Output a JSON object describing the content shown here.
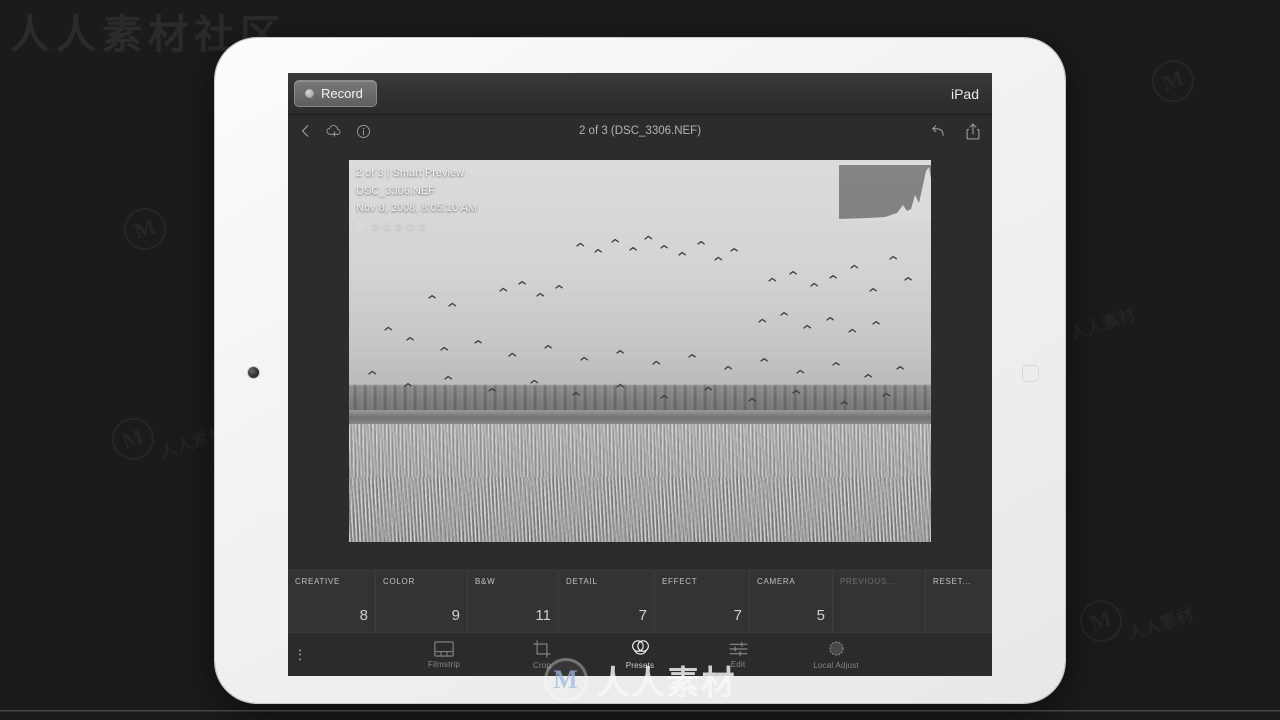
{
  "background": {
    "site_watermark": "人人素材社区",
    "logo_text": "人人素材",
    "logo_mark": "M",
    "tile_watermark": "人人素材"
  },
  "device": {
    "name": "iPad",
    "camera_icon": "front-camera",
    "home_icon": "home-button"
  },
  "recorder": {
    "record_label": "Record",
    "record_dot_icon": "record-dot",
    "device_label": "iPad"
  },
  "app": {
    "topnav": {
      "back_icon": "chevron-left-icon",
      "cloud_icon": "cloud-add-icon",
      "info_icon": "info-circle-icon",
      "title": "2 of 3 (DSC_3306.NEF)",
      "undo_icon": "undo-icon",
      "share_icon": "share-upload-icon"
    },
    "photo_overlay": {
      "line1": "2 of 3 | Smart Preview",
      "line2": "DSC_3306.NEF",
      "line3": "Nov 8, 2008, 8:05:10 AM",
      "flag_icon": "flag-outline-icon",
      "stars": "☆☆☆☆☆",
      "histogram_icon": "histogram-overlay"
    },
    "presets": {
      "columns": [
        {
          "name": "CREATIVE",
          "count": "8",
          "disabled": false
        },
        {
          "name": "COLOR",
          "count": "9",
          "disabled": false
        },
        {
          "name": "B&W",
          "count": "11",
          "disabled": false
        },
        {
          "name": "DETAIL",
          "count": "7",
          "disabled": false
        },
        {
          "name": "EFFECT",
          "count": "7",
          "disabled": false
        },
        {
          "name": "CAMERA",
          "count": "5",
          "disabled": false
        },
        {
          "name": "PREVIOUS...",
          "count": "",
          "disabled": true
        },
        {
          "name": "RESET...",
          "count": "",
          "disabled": false
        }
      ]
    },
    "toolbar": {
      "more_icon": "more-vertical-icon",
      "items": [
        {
          "label": "Filmstrip",
          "icon": "filmstrip-icon",
          "active": false
        },
        {
          "label": "Crop",
          "icon": "crop-icon",
          "active": false
        },
        {
          "label": "Presets",
          "icon": "presets-icon",
          "active": true
        },
        {
          "label": "Edit",
          "icon": "sliders-icon",
          "active": false
        },
        {
          "label": "Local Adjust",
          "icon": "local-adjust-icon",
          "active": false
        }
      ]
    }
  },
  "colors": {
    "app_background": "#2c2c2c",
    "panel_background": "#333333",
    "accent_text": "#cfcfcf"
  }
}
